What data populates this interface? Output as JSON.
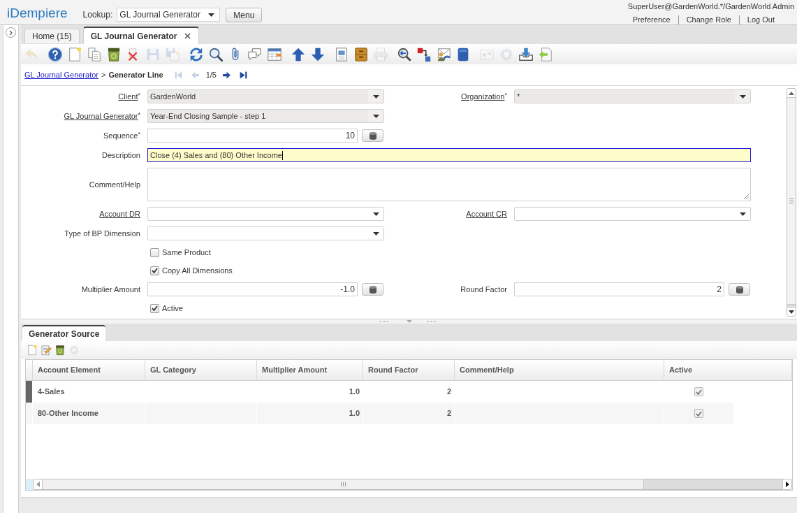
{
  "header": {
    "logo": "iDempiere",
    "lookup_label": "Lookup:",
    "lookup_value": "GL Journal Generator",
    "menu_button": "Menu",
    "user": "SuperUser@GardenWorld.*/GardenWorld Admin",
    "links": [
      "Preference",
      "Change Role",
      "Log Out"
    ]
  },
  "window_tabs": [
    {
      "label": "Home (15)",
      "selected": false,
      "closable": false
    },
    {
      "label": "GL Journal Generator",
      "selected": true,
      "closable": true
    }
  ],
  "toolbar": [
    {
      "items": [
        {
          "kind": "undo",
          "disabled": true
        }
      ]
    },
    {
      "items": [
        {
          "kind": "help",
          "disabled": false
        },
        {
          "kind": "new",
          "disabled": false
        },
        {
          "kind": "copy",
          "disabled": false
        },
        {
          "kind": "delete",
          "disabled": false
        },
        {
          "kind": "delete_selection",
          "disabled": false
        },
        {
          "kind": "save",
          "disabled": true
        },
        {
          "kind": "save_new",
          "disabled": true
        }
      ]
    },
    {
      "items": [
        {
          "kind": "refresh",
          "disabled": false
        },
        {
          "kind": "find",
          "disabled": false
        },
        {
          "kind": "attachment",
          "disabled": false
        },
        {
          "kind": "chat",
          "disabled": false
        },
        {
          "kind": "grid",
          "disabled": false
        }
      ]
    },
    {
      "items": [
        {
          "kind": "up",
          "disabled": false
        },
        {
          "kind": "down",
          "disabled": false
        }
      ]
    },
    {
      "items": [
        {
          "kind": "report",
          "disabled": false
        },
        {
          "kind": "archive",
          "disabled": false
        },
        {
          "kind": "print",
          "disabled": true
        }
      ]
    },
    {
      "items": [
        {
          "kind": "zoom",
          "disabled": false
        },
        {
          "kind": "workflow",
          "disabled": false
        },
        {
          "kind": "request",
          "disabled": false
        },
        {
          "kind": "product",
          "disabled": false
        }
      ]
    },
    {
      "items": [
        {
          "kind": "window",
          "disabled": true
        },
        {
          "kind": "process",
          "disabled": true
        },
        {
          "kind": "import",
          "disabled": false
        },
        {
          "kind": "export",
          "disabled": false
        }
      ]
    }
  ],
  "breadcrumb": {
    "parent": "GL Journal Generator",
    "separator": ">",
    "current": "Generator Line",
    "back": [
      {
        "kind": "first",
        "disabled": true
      },
      {
        "kind": "previous",
        "disabled": true
      }
    ],
    "record": "1/5",
    "forward": [
      {
        "kind": "next",
        "disabled": false
      },
      {
        "kind": "last",
        "disabled": false
      }
    ]
  },
  "form": {
    "rows": [
      {
        "fields": [
          {
            "kind": "select",
            "label": "Client",
            "mark": "*",
            "link": true,
            "readonly": true,
            "value": "GardenWorld"
          },
          {
            "kind": "select",
            "label": "Organization",
            "mark": "*",
            "link": true,
            "readonly": true,
            "value": "*"
          }
        ]
      },
      {
        "fields": [
          {
            "kind": "select",
            "label": "GL Journal Generator",
            "mark": "*",
            "link": true,
            "readonly": true,
            "value": "Year-End Closing Sample - step 1"
          }
        ]
      },
      {
        "fields": [
          {
            "kind": "number",
            "label": "Sequence",
            "mark": "*",
            "link": false,
            "focused": false,
            "value": "10"
          }
        ]
      },
      {
        "fields": [
          {
            "kind": "text",
            "label": "Description",
            "link": false,
            "focused": true,
            "value": "Close (4) Sales and (80) Other Income"
          }
        ]
      },
      {
        "fields": [
          {
            "kind": "textarea",
            "label": "Comment/Help",
            "link": false,
            "focused": false
          }
        ]
      },
      {
        "fields": [
          {
            "kind": "select",
            "label": "Account DR",
            "link": true,
            "readonly": false
          },
          {
            "kind": "select",
            "label": "Account CR",
            "link": true,
            "readonly": false
          }
        ]
      },
      {
        "fields": [
          {
            "kind": "select",
            "label": "Type of BP Dimension",
            "link": false,
            "readonly": false
          }
        ]
      },
      {
        "fields": [
          {
            "kind": "checkbox",
            "label": "Same Product",
            "checked": false
          }
        ]
      },
      {
        "fields": [
          {
            "kind": "checkbox",
            "label": "Copy All Dimensions",
            "checked": true
          }
        ]
      },
      {
        "fields": [
          {
            "kind": "number",
            "label": "Multiplier Amount",
            "link": false,
            "focused": false,
            "value": "-1.0"
          },
          {
            "kind": "number",
            "label": "Round Factor",
            "link": false,
            "focused": false,
            "value": "2"
          }
        ]
      },
      {
        "fields": [
          {
            "kind": "checkbox",
            "label": "Active",
            "checked": true
          }
        ]
      }
    ]
  },
  "detail": {
    "tabs": [
      {
        "label": "Generator Source",
        "selected": true
      }
    ],
    "toolbar": [
      {
        "kind": "new",
        "disabled": false
      },
      {
        "kind": "edit",
        "disabled": false
      },
      {
        "kind": "delete",
        "disabled": false
      },
      {
        "kind": "process",
        "disabled": true
      }
    ],
    "table": {
      "columns": [
        {
          "label": "Account Element",
          "kind": "text"
        },
        {
          "label": "GL Category",
          "kind": "text"
        },
        {
          "label": "Multiplier Amount",
          "kind": "number"
        },
        {
          "label": "Round Factor",
          "kind": "number"
        },
        {
          "label": "Comment/Help",
          "kind": "text"
        },
        {
          "label": "Active",
          "kind": "check"
        }
      ],
      "rows": [
        {
          "selected": true,
          "account_element": "4-Sales",
          "multiplier_amount": "1.0",
          "round_factor": "2",
          "active": true
        },
        {
          "selected": false,
          "account_element": "80-Other Income",
          "multiplier_amount": "1.0",
          "round_factor": "2",
          "active": true
        }
      ]
    }
  }
}
